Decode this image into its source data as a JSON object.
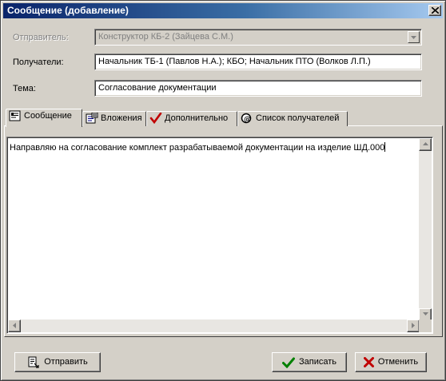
{
  "window": {
    "title": "Сообщение (добавление)"
  },
  "form": {
    "sender_label": "Отправитель:",
    "sender_value": "Конструктор КБ-2 (Зайцева С.М.)",
    "recipients_label": "Получатели:",
    "recipients_value": "Начальник ТБ-1 (Павлов Н.А.); КБО; Начальник ПТО (Волков Л.П.)",
    "subject_label": "Тема:",
    "subject_value": "Согласование документации"
  },
  "tabs": [
    {
      "label": "Сообщение",
      "icon": "message-icon",
      "active": true
    },
    {
      "label": "Вложения",
      "icon": "attachments-icon",
      "active": false
    },
    {
      "label": "Дополнительно",
      "icon": "checkmark-icon",
      "active": false
    },
    {
      "label": "Список получателей",
      "icon": "recipients-icon",
      "active": false
    }
  ],
  "message": {
    "body": "Направляю на согласование комплект разрабатываемой документации на изделие ШД.000"
  },
  "buttons": {
    "send": "Отправить",
    "save": "Записать",
    "cancel": "Отменить"
  },
  "colors": {
    "window_bg": "#d4d0c8",
    "title_start": "#0a246a",
    "title_end": "#a6caf0",
    "save_icon": "#008000",
    "cancel_icon": "#c00000"
  }
}
